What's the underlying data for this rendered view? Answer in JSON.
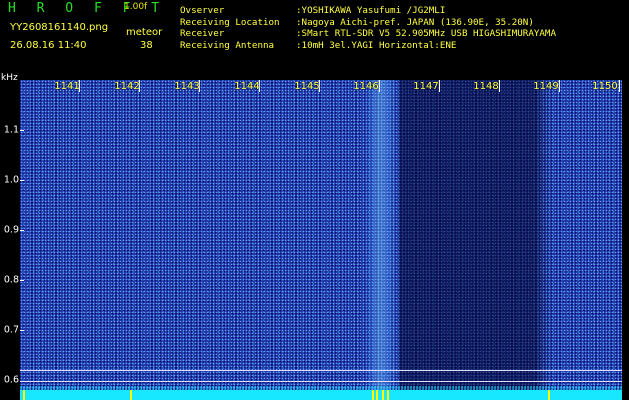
{
  "header": {
    "app_title": "H R O F F T",
    "version": "1.00f",
    "filename": "YY2608161140.png",
    "datetime": "26.08.16 11:40",
    "meteor_label": "meteor",
    "meteor_count": "38"
  },
  "station": [
    {
      "key": "Ovserver",
      "value": ":YOSHIKAWA Yasufumi /JG2MLI"
    },
    {
      "key": "Receiving Location",
      "value": ":Nagoya Aichi-pref. JAPAN (136.90E, 35.20N)"
    },
    {
      "key": "Receiver",
      "value": ":SMart RTL-SDR V5 52.905MHz USB HIGASHIMURAYAMA"
    },
    {
      "key": "Receiving Antenna",
      "value": ":10mH 3el.YAGI Horizontal:ENE"
    }
  ],
  "axis": {
    "unit": "kHz",
    "y_labels": [
      "1.1",
      "1.0",
      "0.9",
      "0.8",
      "0.7",
      "0.6"
    ],
    "x_labels": [
      "1141",
      "1142",
      "1143",
      "1144",
      "1145",
      "1146",
      "1147",
      "1148",
      "1149",
      "1150"
    ]
  },
  "colors": {
    "background": "#000000",
    "spectrogram": "#1c2fb2",
    "label_yellow": "#ffff40",
    "title_green": "#24e024",
    "baseline_cyan": "#18e8ff"
  }
}
